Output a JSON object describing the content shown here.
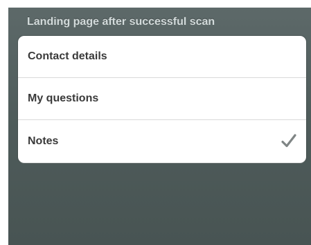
{
  "section": {
    "title": "Landing page after successful scan"
  },
  "options": [
    {
      "label": "Contact details",
      "selected": false
    },
    {
      "label": "My questions",
      "selected": false
    },
    {
      "label": "Notes",
      "selected": true,
      "accessory_icon": "checkmark-icon"
    }
  ],
  "colors": {
    "background": "#4f5c5b",
    "header_text": "#d3dbdb",
    "row_text": "#3a3a3a",
    "checkmark": "#7f8585"
  }
}
